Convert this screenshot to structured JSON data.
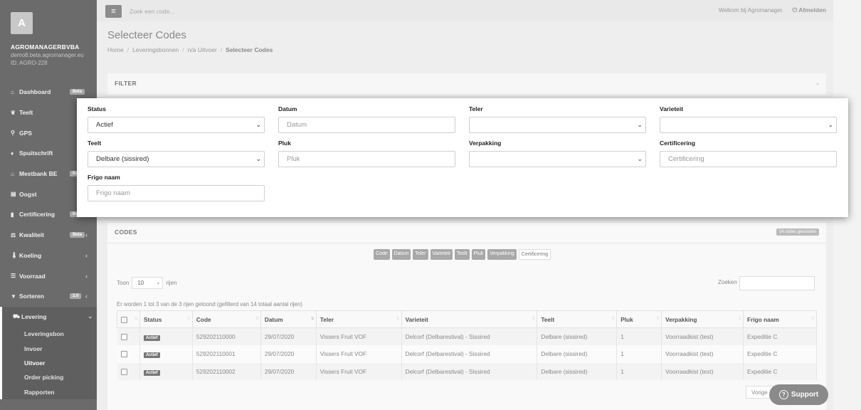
{
  "sidebar": {
    "avatar_letter": "A",
    "company": "AGROMANAGERBVBA",
    "email": "demo8.beta.agromanager.eu",
    "user_id": "ID: AGRO-228",
    "items": [
      {
        "label": "Dashboard",
        "icon": "home-icon",
        "glyph": "⌂",
        "badge": "Beta",
        "chevron": ""
      },
      {
        "label": "Teelt",
        "icon": "leaf-icon",
        "glyph": "❦",
        "badge": "",
        "chevron": ""
      },
      {
        "label": "GPS",
        "icon": "map-marker-icon",
        "glyph": "⚲",
        "badge": "",
        "chevron": ""
      },
      {
        "label": "Spuitschrift",
        "icon": "drop-icon",
        "glyph": "♦",
        "badge": "",
        "chevron": ""
      },
      {
        "label": "Mestbank BE",
        "icon": "bank-icon",
        "glyph": "⌂",
        "badge": "Be",
        "chevron": ""
      },
      {
        "label": "Oogst",
        "icon": "basket-icon",
        "glyph": "▤",
        "badge": "",
        "chevron": ""
      },
      {
        "label": "Certificering",
        "icon": "certificate-icon",
        "glyph": "▮",
        "badge": "Be",
        "chevron": ""
      },
      {
        "label": "Kwaliteit",
        "icon": "balance-icon",
        "glyph": "⚖",
        "badge": "Beta",
        "chevron": "‹"
      },
      {
        "label": "Koeling",
        "icon": "thermometer-icon",
        "glyph": "🌡",
        "badge": "",
        "chevron": "‹"
      },
      {
        "label": "Voorraad",
        "icon": "list-icon",
        "glyph": "☰",
        "badge": "",
        "chevron": "‹"
      },
      {
        "label": "Sorteren",
        "icon": "filter-icon",
        "glyph": "▼",
        "badge": "2.0",
        "chevron": "‹"
      }
    ],
    "active_item": {
      "label": "Levering",
      "icon": "truck-icon",
      "glyph": "⛟",
      "chevron": "⌄"
    },
    "sub_items": [
      "Leveringsbon",
      "Invoer",
      "Uitvoer",
      "Order picking",
      "Rapporten"
    ]
  },
  "topbar": {
    "menu_glyph": "≡",
    "search_placeholder": "Zoek een code...",
    "welcome": "Welkom bij Agromanager.",
    "logout": "⏻ Afmelden"
  },
  "page": {
    "title": "Selecteer Codes",
    "breadcrumb": [
      "Home",
      "Leveringsbonnen",
      "n/a Uitvoer",
      "Selecteer Codes"
    ]
  },
  "filter": {
    "title": "FILTER",
    "fields": {
      "status": {
        "label": "Status",
        "value": "Actief"
      },
      "datum": {
        "label": "Datum",
        "placeholder": "Datum"
      },
      "teler": {
        "label": "Teler",
        "value": ""
      },
      "varieteit": {
        "label": "Varieteit",
        "value": ""
      },
      "teelt": {
        "label": "Teelt",
        "value": "Delbare (sissired)"
      },
      "pluk": {
        "label": "Pluk",
        "placeholder": "Pluk"
      },
      "verpakking": {
        "label": "Verpakking",
        "value": ""
      },
      "certificering": {
        "label": "Certificering",
        "placeholder": "Certificering"
      },
      "frigo_naam": {
        "label": "Frigo naam",
        "placeholder": "Frigo naam"
      }
    }
  },
  "codes": {
    "title": "CODES",
    "badge": "14 codes gevonden",
    "column_toggles": [
      {
        "label": "Code",
        "on": true
      },
      {
        "label": "Datum",
        "on": true
      },
      {
        "label": "Teler",
        "on": true
      },
      {
        "label": "Varieteit",
        "on": true
      },
      {
        "label": "Teelt",
        "on": true
      },
      {
        "label": "Pluk",
        "on": true
      },
      {
        "label": "Verpakking",
        "on": true
      },
      {
        "label": "Certificering",
        "on": false
      }
    ],
    "length_label_before": "Toon",
    "length_value": "10",
    "length_label_after": "rijen",
    "search_label": "Zoeken",
    "info": "Er worden 1 tot 3 van de 3 rijen getoond (gefilterd van 14 totaal aantal rijen)",
    "columns": [
      "Status",
      "Code",
      "Datum",
      "Teler",
      "Varieteit",
      "Teelt",
      "Pluk",
      "Verpakking",
      "Frigo naam"
    ],
    "rows": [
      {
        "status": "Actief",
        "code": "529202110000",
        "datum": "29/07/2020",
        "teler": "Vissers Fruit VOF",
        "varieteit": "Delcorf (Delbarestival) - Sissired",
        "teelt": "Delbare (sissired)",
        "pluk": "1",
        "verpakking": "Voorraadkist (test)",
        "frigo": "Expeditie C"
      },
      {
        "status": "Actief",
        "code": "529202110001",
        "datum": "29/07/2020",
        "teler": "Vissers Fruit VOF",
        "varieteit": "Delcorf (Delbarestival) - Sissired",
        "teelt": "Delbare (sissired)",
        "pluk": "1",
        "verpakking": "Voorraadkist (test)",
        "frigo": "Expeditie C"
      },
      {
        "status": "Actief",
        "code": "529202110002",
        "datum": "29/07/2020",
        "teler": "Vissers Fruit VOF",
        "varieteit": "Delcorf (Delbarestival) - Sissired",
        "teelt": "Delbare (sissired)",
        "pluk": "1",
        "verpakking": "Voorraadkist (test)",
        "frigo": "Expeditie C"
      }
    ],
    "prev_label": "Vorige"
  },
  "support": {
    "label": "Support",
    "glyph": "?"
  }
}
